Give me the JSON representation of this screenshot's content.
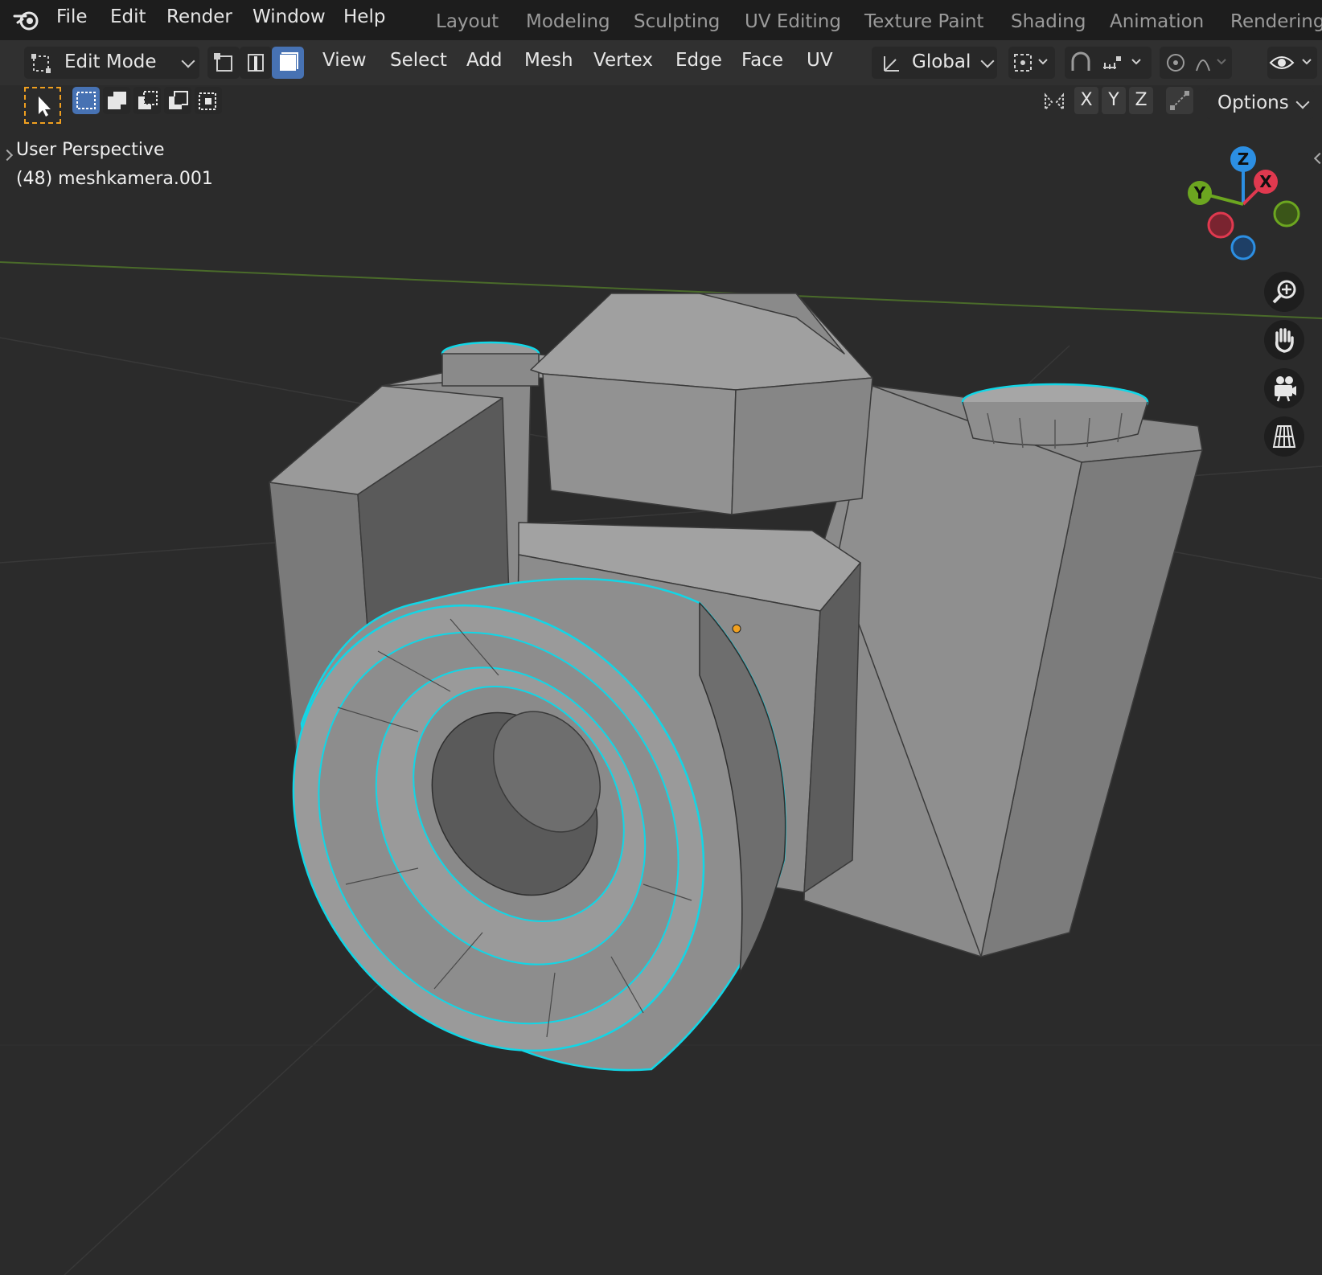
{
  "topbar": {
    "menus": [
      "File",
      "Edit",
      "Render",
      "Window",
      "Help"
    ],
    "workspaces": [
      "Layout",
      "Modeling",
      "Sculpting",
      "UV Editing",
      "Texture Paint",
      "Shading",
      "Animation",
      "Rendering"
    ]
  },
  "header": {
    "mode_label": "Edit Mode",
    "menus": [
      "View",
      "Select",
      "Add",
      "Mesh",
      "Vertex",
      "Edge",
      "Face",
      "UV"
    ],
    "orientation_label": "Global",
    "select_mode_active": "face"
  },
  "toolrow": {
    "axes": [
      "X",
      "Y",
      "Z"
    ],
    "options_label": "Options"
  },
  "viewport": {
    "view_label": "User Perspective",
    "object_label": "(48) meshkamera.001"
  },
  "gizmo": {
    "axis_labels": [
      "Z",
      "X",
      "Y"
    ],
    "colors": {
      "x": "#e0394f",
      "y": "#6ca620",
      "z": "#2c8fe3"
    }
  },
  "colors": {
    "accent": "#4772b3",
    "selection_edge": "#12d6e6",
    "active_tool_outline": "#f0a020"
  }
}
